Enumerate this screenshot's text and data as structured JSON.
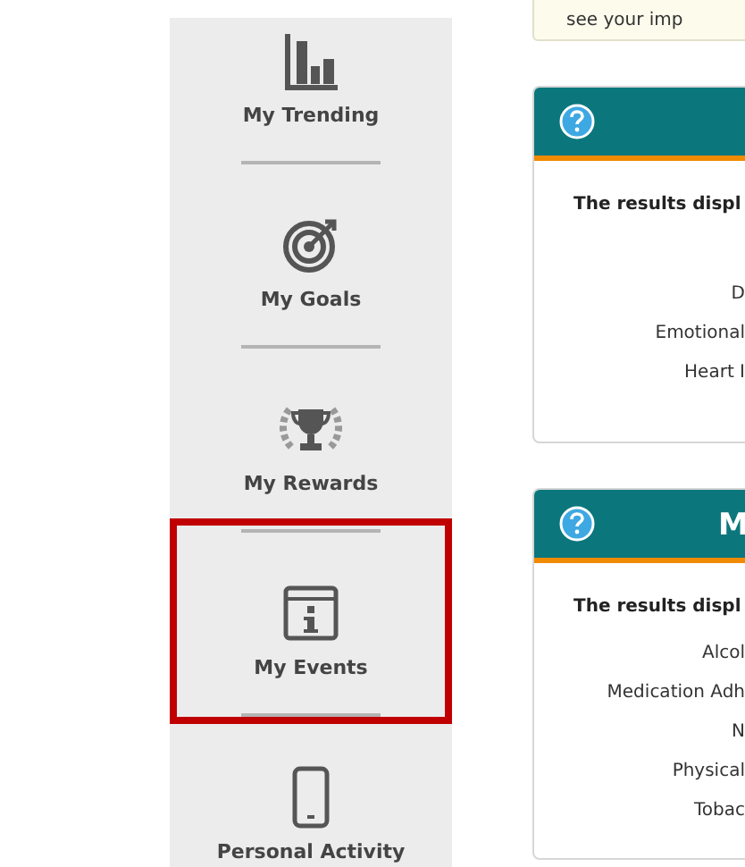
{
  "sidebar": {
    "items": [
      {
        "kind": "trending",
        "label": "My Trending",
        "selected": false
      },
      {
        "kind": "goals",
        "label": "My Goals",
        "selected": false
      },
      {
        "kind": "rewards",
        "label": "My Rewards",
        "selected": false
      },
      {
        "kind": "events",
        "label": "My Events",
        "selected": true
      },
      {
        "kind": "device",
        "label": "Personal Activity",
        "selected": false
      }
    ]
  },
  "notice": {
    "text": "see your imp"
  },
  "cards": [
    {
      "intro": "The results displ",
      "rows": [
        "D",
        "Emotional",
        "Heart I"
      ]
    },
    {
      "title": "M",
      "intro": "The results displ",
      "rows": [
        "Alcol",
        "Medication Adh",
        "N",
        "Physical",
        "Tobac"
      ]
    }
  ]
}
